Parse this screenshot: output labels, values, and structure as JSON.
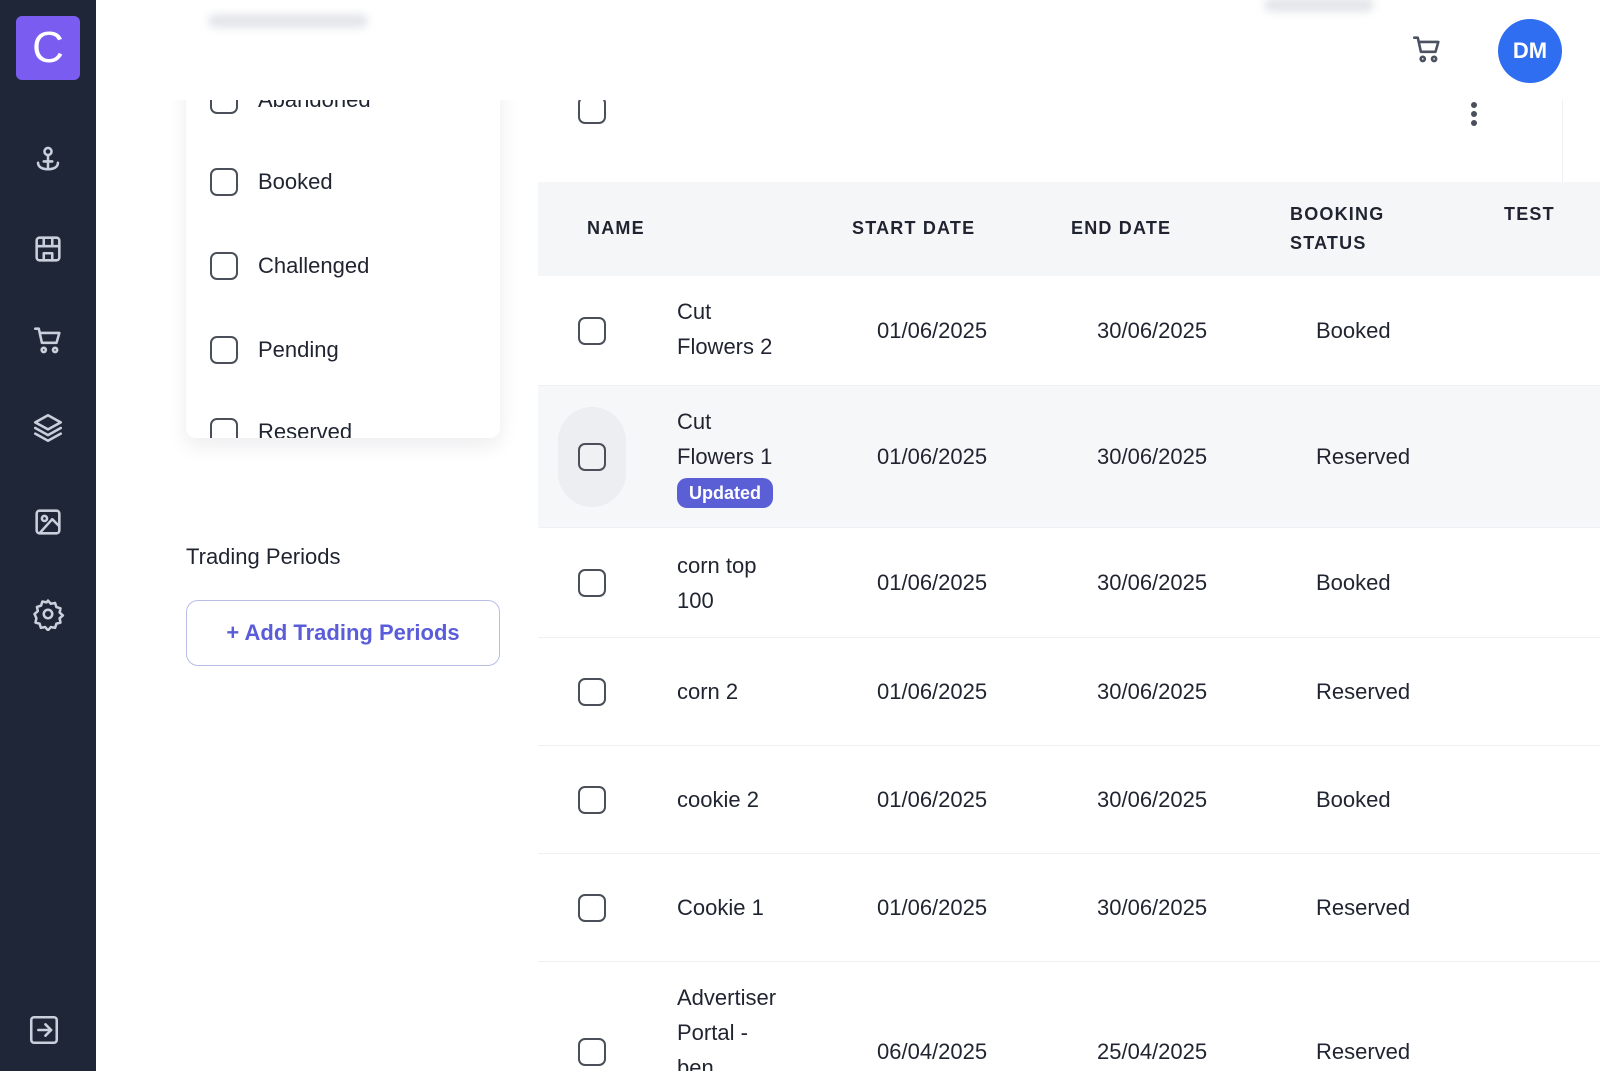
{
  "logo": {
    "letter": "C"
  },
  "user": {
    "initials": "DM"
  },
  "filters": {
    "options": [
      "Abandoned",
      "Booked",
      "Challenged",
      "Pending",
      "Reserved"
    ]
  },
  "trading_periods": {
    "label": "Trading Periods",
    "add_button": "+ Add Trading Periods"
  },
  "table": {
    "columns": {
      "name": "NAME",
      "start_date": "START DATE",
      "end_date": "END DATE",
      "booking_status_1": "BOOKING",
      "booking_status_2": "STATUS",
      "test": "TEST"
    },
    "rows": [
      {
        "name_1": "Cut",
        "name_2": "Flowers 2",
        "start": "01/06/2025",
        "end": "30/06/2025",
        "status": "Booked"
      },
      {
        "name_1": "Cut",
        "name_2": "Flowers 1",
        "badge": "Updated",
        "start": "01/06/2025",
        "end": "30/06/2025",
        "status": "Reserved"
      },
      {
        "name_1": "corn top",
        "name_2": "100",
        "start": "01/06/2025",
        "end": "30/06/2025",
        "status": "Booked"
      },
      {
        "name_1": "corn 2",
        "start": "01/06/2025",
        "end": "30/06/2025",
        "status": "Reserved"
      },
      {
        "name_1": "cookie 2",
        "start": "01/06/2025",
        "end": "30/06/2025",
        "status": "Booked"
      },
      {
        "name_1": "Cookie 1",
        "start": "01/06/2025",
        "end": "30/06/2025",
        "status": "Reserved"
      },
      {
        "name_1": "Advertiser",
        "name_2": "Portal -",
        "name_3": "ben",
        "start": "06/04/2025",
        "end": "25/04/2025",
        "status": "Reserved"
      }
    ]
  },
  "colors": {
    "sidebar": "#1e2638",
    "brand": "#7b5cf0",
    "avatar": "#2f6ef0",
    "badge": "#5b5fd6",
    "accent_text": "#5a5cd9"
  }
}
